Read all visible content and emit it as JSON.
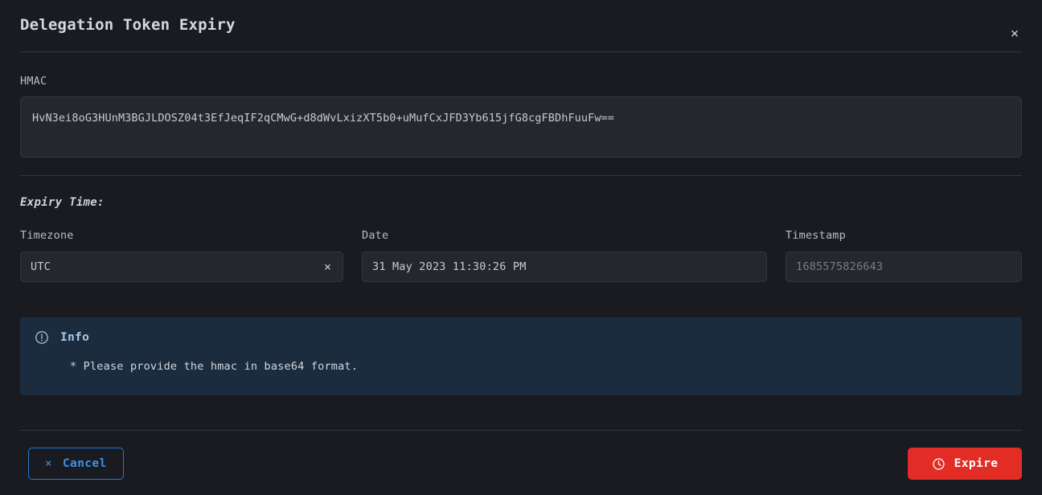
{
  "dialog": {
    "title": "Delegation Token Expiry",
    "close_icon": "close-icon",
    "close_label": "×"
  },
  "hmac": {
    "label": "HMAC",
    "value": "HvN3ei8oG3HUnM3BGJLDOSZ04t3EfJeqIF2qCMwG+d8dWvLxizXT5b0+uMufCxJFD3Yb615jfG8cgFBDhFuuFw==",
    "placeholder": ""
  },
  "expiry": {
    "section_title": "Expiry Time:",
    "timezone": {
      "label": "Timezone",
      "value": "UTC",
      "clear_label": "×",
      "clear_icon": "close-icon"
    },
    "date": {
      "label": "Date",
      "value": "31 May 2023 11:30:26 PM"
    },
    "timestamp": {
      "label": "Timestamp",
      "value": "1685575826643",
      "is_placeholder": true
    }
  },
  "info": {
    "icon": "exclamation-circle-icon",
    "title": "Info",
    "text": "* Please provide the hmac in base64 format."
  },
  "footer": {
    "cancel": {
      "label": "Cancel",
      "icon": "close-icon",
      "icon_glyph": "×"
    },
    "expire": {
      "label": "Expire",
      "icon": "clock-icon"
    }
  },
  "colors": {
    "background": "#1a1b20",
    "field_background": "#26272d",
    "border": "#34363d",
    "accent_blue": "#3b92e6",
    "info_background": "#1b2c3f",
    "info_accent": "#a9c9e8",
    "danger_red": "#e22d26",
    "text_primary": "#c6cad2",
    "text_muted": "#787c85"
  }
}
